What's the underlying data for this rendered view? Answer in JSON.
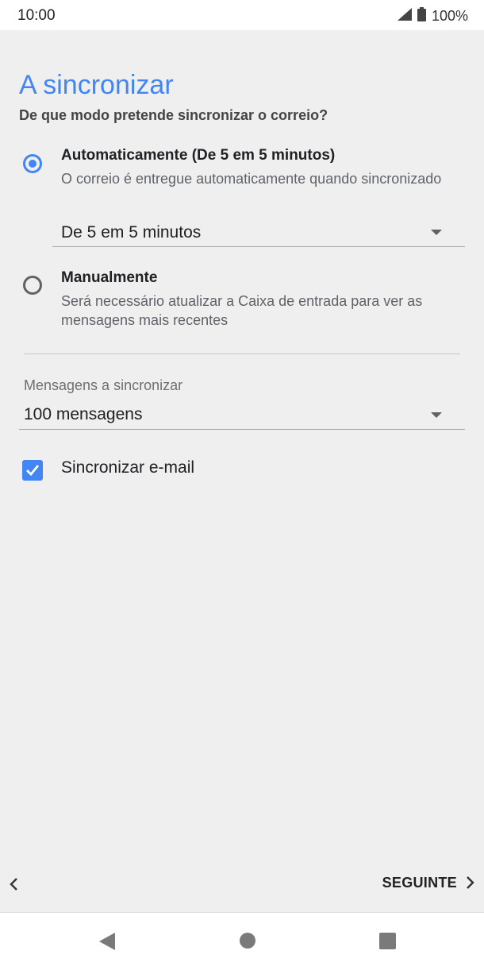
{
  "status_bar": {
    "time": "10:00",
    "battery": "100%"
  },
  "screen": {
    "title": "A sincronizar",
    "subtitle": "De que modo pretende sincronizar o correio?"
  },
  "sync_options": {
    "automatic": {
      "title": "Automaticamente (De 5 em 5 minutos)",
      "description": "O correio é entregue automaticamente quando sincronizado",
      "selected": true,
      "interval_value": "De 5 em 5 minutos"
    },
    "manual": {
      "title": "Manualmente",
      "description": "Será necessário atualizar a Caixa de entrada para ver as mensagens mais recentes",
      "selected": false
    }
  },
  "messages_to_sync": {
    "label": "Mensagens a sincronizar",
    "value": "100 mensagens"
  },
  "sync_email": {
    "label": "Sincronizar e-mail",
    "checked": true
  },
  "footer": {
    "next_label": "SEGUINTE"
  },
  "colors": {
    "accent": "#4285f4",
    "background": "#efefef"
  },
  "icons": [
    "signal-icon",
    "battery-icon",
    "chevron-down-icon",
    "check-icon",
    "chevron-left-icon",
    "chevron-right-icon",
    "nav-back-icon",
    "nav-home-icon",
    "nav-recents-icon"
  ]
}
